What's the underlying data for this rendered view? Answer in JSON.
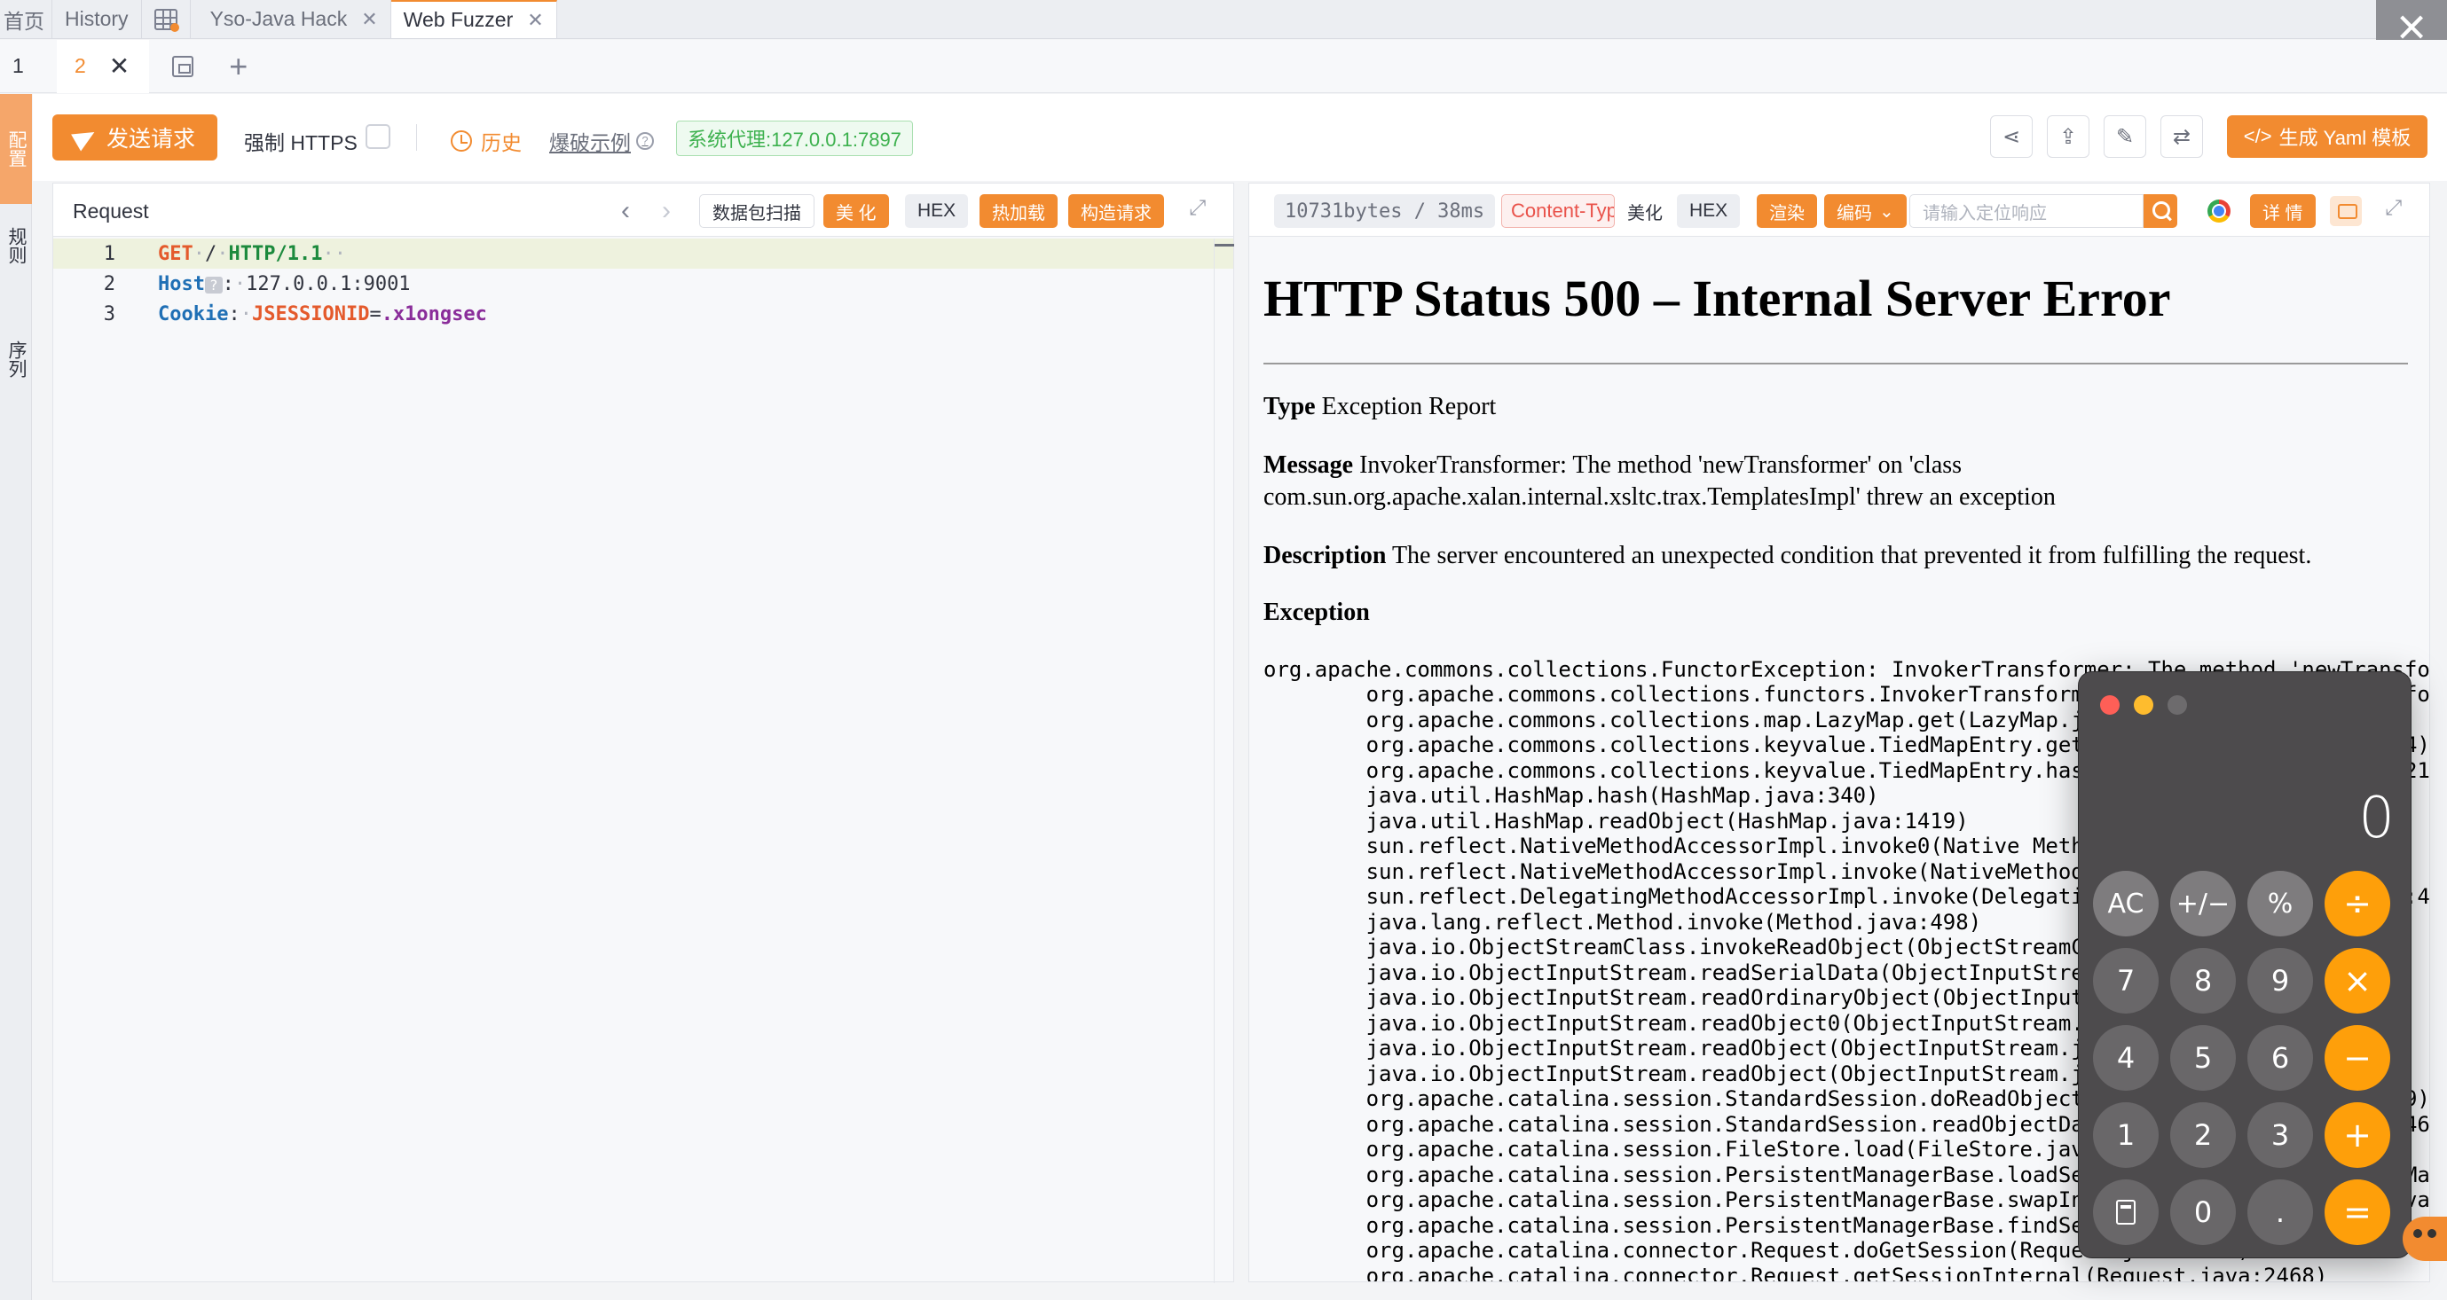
{
  "tabs": [
    {
      "label": "首页"
    },
    {
      "label": "History"
    },
    {
      "label": "Yso-Java Hack"
    },
    {
      "label": "Web Fuzzer"
    }
  ],
  "subtabs": {
    "first": "1",
    "active": "2"
  },
  "sidebar": {
    "rule_label": "配置",
    "items": [
      "规则",
      "序列"
    ]
  },
  "toolbar": {
    "send_label": "发送请求",
    "https_label": "强制 HTTPS",
    "history_label": "历史",
    "example_label": "爆破示例",
    "proxy_label": "系统代理:127.0.0.1:7897",
    "yaml_label": "生成 Yaml 模板"
  },
  "request": {
    "title": "Request",
    "buttons": {
      "scan": "数据包扫描",
      "beautify": "美 化",
      "hex": "HEX",
      "hotload": "热加载",
      "build": "构造请求"
    },
    "lines": [
      {
        "no": "1",
        "method": "GET",
        "path": "/",
        "proto": "HTTP/1.1"
      },
      {
        "no": "2",
        "key": "Host",
        "value": "127.0.0.1:9001"
      },
      {
        "no": "3",
        "key": "Cookie",
        "cookie_name": "JSESSIONID",
        "cookie_value": ".x1ongsec"
      }
    ]
  },
  "response": {
    "bytes": "10731bytes / 38ms",
    "content_type": "Content-Type",
    "beautify": "美化",
    "hex": "HEX",
    "render": "渲染",
    "encoding": "编码",
    "search_placeholder": "请输入定位响应",
    "details": "详 情",
    "page": {
      "title": "HTTP Status 500 – Internal Server Error",
      "type_label": "Type",
      "type_value": "Exception Report",
      "message_label": "Message",
      "message_value": "InvokerTransformer: The method 'newTransformer' on 'class com.sun.org.apache.xalan.internal.xsltc.trax.TemplatesImpl' threw an exception",
      "description_label": "Description",
      "description_value": "The server encountered an unexpected condition that prevented it from fulfilling the request.",
      "exception_label": "Exception",
      "stack": "org.apache.commons.collections.FunctorException: InvokerTransformer: The method 'newTransformer' on 'class com.sun.org.apache.xalan.internal.xsltc.trax.TemplatesImpl' threw an exception\n\torg.apache.commons.collections.functors.InvokerTransformer.transform(InvokerTransformer.java:132)\n\torg.apache.commons.collections.map.LazyMap.get(LazyMap.java:158)\n\torg.apache.commons.collections.keyvalue.TiedMapEntry.getValue(TiedMapEntry.java:74)\n\torg.apache.commons.collections.keyvalue.TiedMapEntry.hashCode(TiedMapEntry.java:121)\n\tjava.util.HashMap.hash(HashMap.java:340)\n\tjava.util.HashMap.readObject(HashMap.java:1419)\n\tsun.reflect.NativeMethodAccessorImpl.invoke0(Native Method)\n\tsun.reflect.NativeMethodAccessorImpl.invoke(NativeMethodAccessorImpl.java:62)\n\tsun.reflect.DelegatingMethodAccessorImpl.invoke(DelegatingMethodAccessorImpl.java:43)\n\tjava.lang.reflect.Method.invoke(Method.java:498)\n\tjava.io.ObjectStreamClass.invokeReadObject(ObjectStreamClass.java:1170)\n\tjava.io.ObjectInputStream.readSerialData(ObjectInputStream.java:2178)\n\tjava.io.ObjectInputStream.readOrdinaryObject(ObjectInputStream.java:2069)\n\tjava.io.ObjectInputStream.readObject0(ObjectInputStream.java:1573)\n\tjava.io.ObjectInputStream.readObject(ObjectInputStream.java:431)\n\tjava.io.ObjectInputStream.readObject(ObjectInputStream.java:423)\n\torg.apache.catalina.session.StandardSession.doReadObject(StandardSession.java:1199)\n\torg.apache.catalina.session.StandardSession.readObjectData(StandardSession.java:846)\n\torg.apache.catalina.session.FileStore.load(FileStore.java:203)\n\torg.apache.catalina.session.PersistentManagerBase.loadSessionFromStore(PersistentManagerBase.java:723)\n\torg.apache.catalina.session.PersistentManagerBase.swapIn(PersistentManagerBase.java:672)\n\torg.apache.catalina.session.PersistentManagerBase.findSession(PersistentManagerBase.java:467)\n\torg.apache.catalina.connector.Request.doGetSession(Request.java:2729)\n\torg.apache.catalina.connector.Request.getSessionInternal(Request.java:2468)"
    }
  },
  "calculator": {
    "display": "0",
    "keys": {
      "ac": "AC",
      "sign": "+∕−",
      "percent": "%",
      "divide": "÷",
      "seven": "7",
      "eight": "8",
      "nine": "9",
      "multiply": "×",
      "four": "4",
      "five": "5",
      "six": "6",
      "minus": "−",
      "one": "1",
      "two": "2",
      "three": "3",
      "plus": "+",
      "zero": "0",
      "dot": ".",
      "equals": "="
    }
  }
}
